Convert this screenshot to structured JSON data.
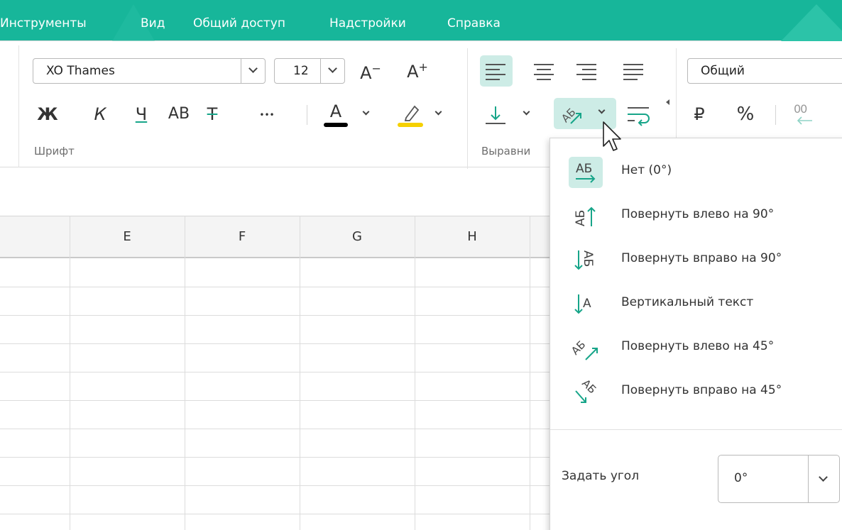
{
  "menubar": {
    "items": [
      "Инструменты",
      "Вид",
      "Общий доступ",
      "Надстройки",
      "Справка"
    ]
  },
  "font_group": {
    "font_name": "XO Thames",
    "font_size": "12",
    "grow_label": "A",
    "grow_sup": "+",
    "shrink_label": "A",
    "shrink_sup": "−",
    "bold": "Ж",
    "italic": "К",
    "underline": "Ч",
    "caps": "АВ",
    "strike": "Т",
    "more": "•••",
    "font_color_letter": "A",
    "font_color": "#000000",
    "highlight_color": "#f5d000",
    "label": "Шрифт"
  },
  "align_group": {
    "label": "Выравни"
  },
  "number_group": {
    "format": "Общий",
    "currency": "₽",
    "percent": "%",
    "decimals": "00"
  },
  "grid": {
    "columns": [
      "E",
      "F",
      "G",
      "H"
    ]
  },
  "rotation_menu": {
    "items": [
      {
        "icon": "АБ",
        "label": "Нет (0°)"
      },
      {
        "icon": "АБ",
        "label": "Повернуть влево на 90°"
      },
      {
        "icon": "АБ",
        "label": "Повернуть вправо на 90°"
      },
      {
        "icon": "А",
        "label": "Вертикальный текст"
      },
      {
        "icon": "АБ",
        "label": "Повернуть влево на 45°"
      },
      {
        "icon": "АБ",
        "label": "Повернуть вправо на 45°"
      }
    ],
    "angle_label": "Задать угол",
    "angle_value": "0°"
  },
  "colors": {
    "accent": "#17b69a",
    "active_bg": "#cdece6",
    "arrow": "#17a589"
  }
}
